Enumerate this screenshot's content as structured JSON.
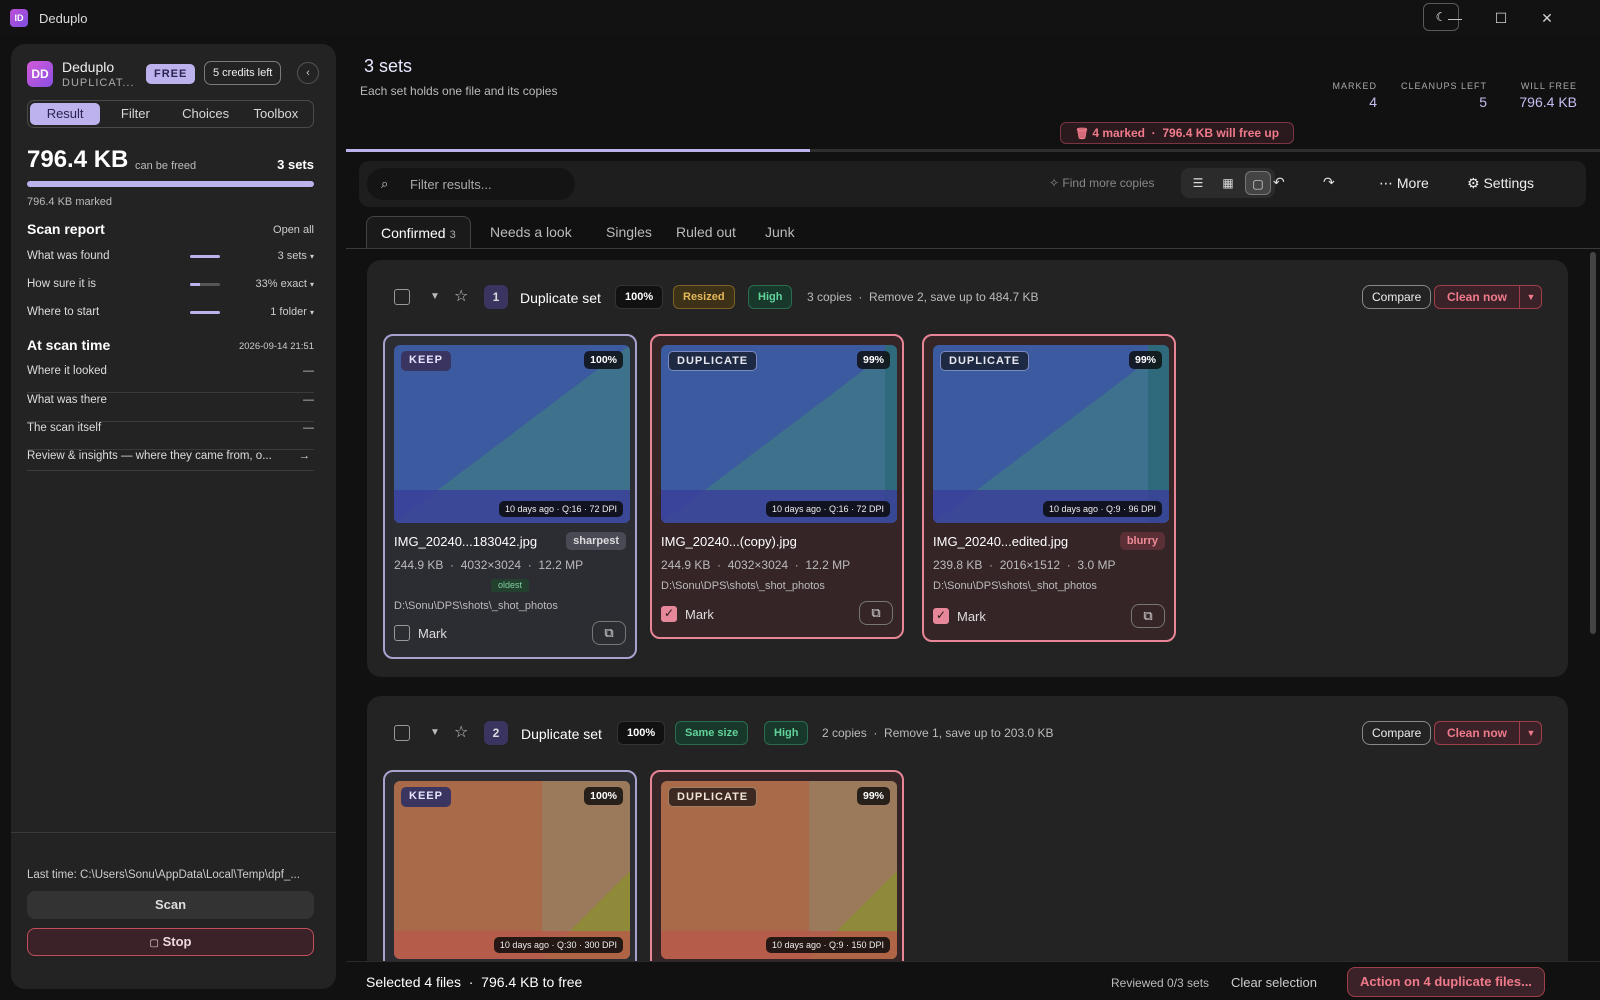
{
  "window": {
    "title": "Deduplo",
    "app_icon": "ID",
    "controls": {
      "theme": "moon-icon",
      "minimize": "—",
      "maximize": "☐",
      "close": "✕"
    }
  },
  "sidebar": {
    "logo": "DD",
    "brand": "Deduplo",
    "brand_sub": "DUPLICAT...",
    "plan_badge": "FREE",
    "credits": "5 credits left",
    "collapse": "‹",
    "tabs": [
      "Result",
      "Filter",
      "Choices",
      "Toolbox"
    ],
    "active_tab": "Result",
    "freeable_size": "796.4 KB",
    "freeable_label": "can be freed",
    "sets_count": "3 sets",
    "freed_fraction": 1.0,
    "marked_text": "796.4 KB marked",
    "scan_report": {
      "title": "Scan report",
      "open_all": "Open all",
      "rows": [
        {
          "label": "What was found",
          "value": "3 sets",
          "level": 1.0
        },
        {
          "label": "How sure it is",
          "value": "33% exact",
          "level": 0.33
        },
        {
          "label": "Where to start",
          "value": "1 folder",
          "level": 1.0
        }
      ]
    },
    "scan_time": {
      "title": "At scan time",
      "timestamp": "2026-09-14 21:51",
      "rows": [
        {
          "label": "Where it looked",
          "value": "—"
        },
        {
          "label": "What was there",
          "value": "—"
        },
        {
          "label": "The scan itself",
          "value": "—"
        }
      ]
    },
    "insights_link": "Review & insights — where they came from, o...",
    "insights_arrow": "→",
    "last_time": "Last time: C:\\Users\\Sonu\\AppData\\Local\\Temp\\dpf_...",
    "scan_label": "Scan",
    "stop_label": "Stop"
  },
  "header": {
    "title": "3 sets",
    "subtitle": "Each set holds one file and its copies",
    "stats": [
      {
        "key": "MARKED",
        "value": "4"
      },
      {
        "key": "CLEANUPS LEFT",
        "value": "5"
      },
      {
        "key": "WILL FREE",
        "value": "796.4 KB"
      }
    ],
    "freeup_banner": "4 marked  ·  796.4 KB will free up",
    "progress": 0.37
  },
  "toolbar": {
    "search_placeholder": "Filter results...",
    "find_more": "Find more copies",
    "more": "More",
    "settings": "Settings"
  },
  "tabs": [
    {
      "label": "Confirmed",
      "count": "3"
    },
    {
      "label": "Needs a look",
      "count": ""
    },
    {
      "label": "Singles",
      "count": ""
    },
    {
      "label": "Ruled out",
      "count": ""
    },
    {
      "label": "Junk",
      "count": ""
    }
  ],
  "sets": [
    {
      "number": "1",
      "title": "Duplicate set",
      "match": "100%",
      "tag": "Resized",
      "confidence": "High",
      "meta": "3 copies  ·  Remove 2, save up to 484.7 KB",
      "compare": "Compare",
      "clean": "Clean now",
      "files": [
        {
          "role": "KEEP",
          "similarity": "100%",
          "chip": "10 days ago · Q:16 · 72 DPI",
          "name": "IMG_20240...183042.jpg",
          "quality": "sharpest",
          "detail": "244.9 KB  ·  4032×3024  ·  12.2 MP",
          "age": "oldest",
          "path": "D:\\Sonu\\DPS\\shots\\_shot_photos",
          "mark": "Mark",
          "marked": false
        },
        {
          "role": "DUPLICATE",
          "similarity": "99%",
          "chip": "10 days ago · Q:16 · 72 DPI",
          "name": "IMG_20240...(copy).jpg",
          "quality": "",
          "detail": "244.9 KB  ·  4032×3024  ·  12.2 MP",
          "age": "",
          "path": "D:\\Sonu\\DPS\\shots\\_shot_photos",
          "mark": "Mark",
          "marked": true
        },
        {
          "role": "DUPLICATE",
          "similarity": "99%",
          "chip": "10 days ago · Q:9 · 96 DPI",
          "name": "IMG_20240...edited.jpg",
          "quality": "blurry",
          "detail": "239.8 KB  ·  2016×1512  ·  3.0 MP",
          "age": "",
          "path": "D:\\Sonu\\DPS\\shots\\_shot_photos",
          "mark": "Mark",
          "marked": true
        }
      ]
    },
    {
      "number": "2",
      "title": "Duplicate set",
      "match": "100%",
      "tag": "Same size",
      "confidence": "High",
      "meta": "2 copies  ·  Remove 1, save up to 203.0 KB",
      "compare": "Compare",
      "clean": "Clean now",
      "files": [
        {
          "role": "KEEP",
          "similarity": "100%",
          "chip": "10 days ago · Q:30 · 300 DPI"
        },
        {
          "role": "DUPLICATE",
          "similarity": "99%",
          "chip": "10 days ago · Q:9 · 150 DPI"
        }
      ]
    }
  ],
  "bottom": {
    "selected": "Selected 4 files  ·  796.4 KB to free",
    "reviewed": "Reviewed 0/3 sets",
    "clear": "Clear selection",
    "action": "Action on 4 duplicate files..."
  },
  "colors": {
    "accent": "#bdb2ee",
    "danger": "#f07a8a",
    "keep_border": "#a7a2cf",
    "dup_border": "#e88596",
    "success": "#62d39a",
    "warn": "#e4b95a"
  }
}
